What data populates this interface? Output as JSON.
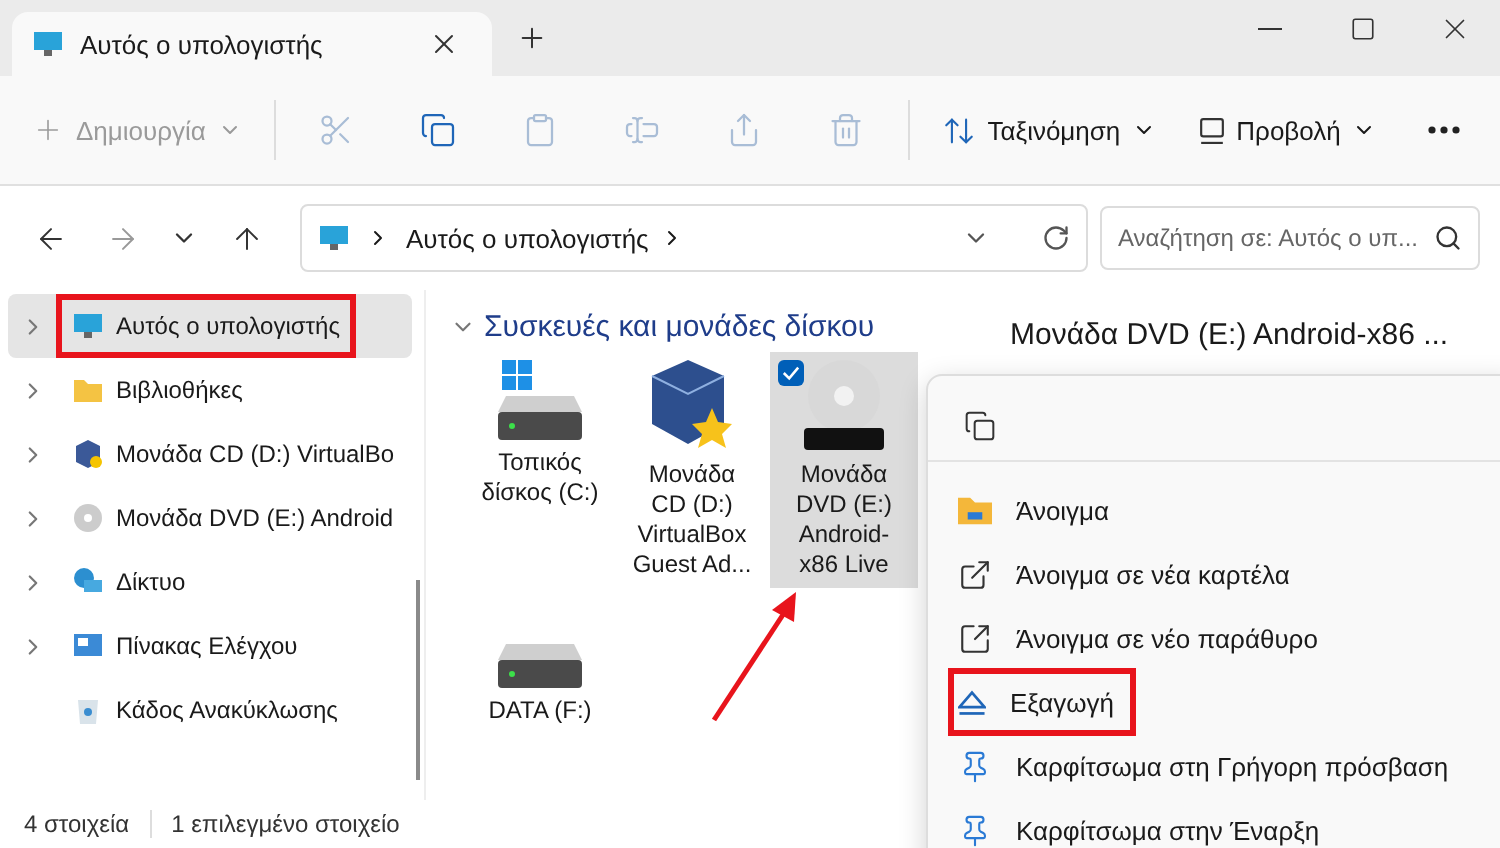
{
  "window": {
    "tabs": [
      {
        "title": "Αυτός ο υπολογιστής",
        "selected": true
      }
    ]
  },
  "toolbar": {
    "new_button": {
      "label": "Δημιουργία",
      "disabled": true
    },
    "actions": [
      {
        "kind": "cut",
        "disabled": true
      },
      {
        "kind": "copy",
        "disabled": false
      },
      {
        "kind": "paste",
        "disabled": true
      },
      {
        "kind": "rename",
        "disabled": true
      },
      {
        "kind": "share",
        "disabled": true
      },
      {
        "kind": "delete",
        "disabled": true
      }
    ],
    "sort": {
      "label": "Ταξινόμηση"
    },
    "view": {
      "label": "Προβολή"
    }
  },
  "address_bar": {
    "path": "Αυτός ο υπολογιστής",
    "search_placeholder": "Αναζήτηση σε: Αυτός ο υπ..."
  },
  "sidebar": {
    "items": [
      {
        "label": "Αυτός ο υπολογιστής",
        "kind": "pc",
        "selected": true,
        "expandable": true,
        "annotated": true
      },
      {
        "label": "Βιβλιοθήκες",
        "kind": "folder",
        "selected": false,
        "expandable": true,
        "annotated": false
      },
      {
        "label": "Μονάδα CD (D:) VirtualBo",
        "kind": "virtualbox",
        "selected": false,
        "expandable": true,
        "annotated": false
      },
      {
        "label": "Μονάδα DVD (E:) Android",
        "kind": "dvd",
        "selected": false,
        "expandable": true,
        "annotated": false
      },
      {
        "label": "Δίκτυο",
        "kind": "network",
        "selected": false,
        "expandable": true,
        "annotated": false
      },
      {
        "label": "Πίνακας Ελέγχου",
        "kind": "control",
        "selected": false,
        "expandable": true,
        "annotated": false
      },
      {
        "label": "Κάδος Ανακύκλωσης",
        "kind": "bin",
        "selected": false,
        "expandable": false,
        "annotated": false
      }
    ]
  },
  "content": {
    "group": {
      "title": "Συσκευές και μονάδες δίσκου",
      "expanded": true
    },
    "drives": [
      {
        "label": "Τοπικός δίσκος (C:)",
        "kind": "system-disk",
        "selected": false,
        "checked": false
      },
      {
        "label": "Μονάδα CD (D:) VirtualBox Guest Ad...",
        "kind": "virtualbox",
        "selected": false,
        "checked": false
      },
      {
        "label": "Μονάδα DVD (E:) Android-x86 Live",
        "kind": "dvd",
        "selected": true,
        "checked": true
      },
      {
        "label": "DATA (F:)",
        "kind": "disk",
        "selected": false,
        "checked": false
      }
    ]
  },
  "details": {
    "title": "Μονάδα DVD (E:) Android-x86 ..."
  },
  "context_menu": {
    "top_actions": [
      {
        "kind": "copy"
      }
    ],
    "items": [
      {
        "label": "Άνοιγμα",
        "kind": "open",
        "annotated": false
      },
      {
        "label": "Άνοιγμα σε νέα καρτέλα",
        "kind": "new-tab",
        "annotated": false
      },
      {
        "label": "Άνοιγμα σε νέο παράθυρο",
        "kind": "new-window",
        "annotated": false
      },
      {
        "label": "Εξαγωγή",
        "kind": "eject",
        "annotated": true
      },
      {
        "label": "Καρφίτσωμα στη Γρήγορη πρόσβαση",
        "kind": "pin",
        "annotated": false
      },
      {
        "label": "Καρφίτσωμα στην Έναρξη",
        "kind": "pin",
        "annotated": false
      }
    ]
  },
  "status_bar": {
    "items": [
      "4 στοιχεία",
      "1 επιλεγμένο στοιχείο"
    ]
  }
}
